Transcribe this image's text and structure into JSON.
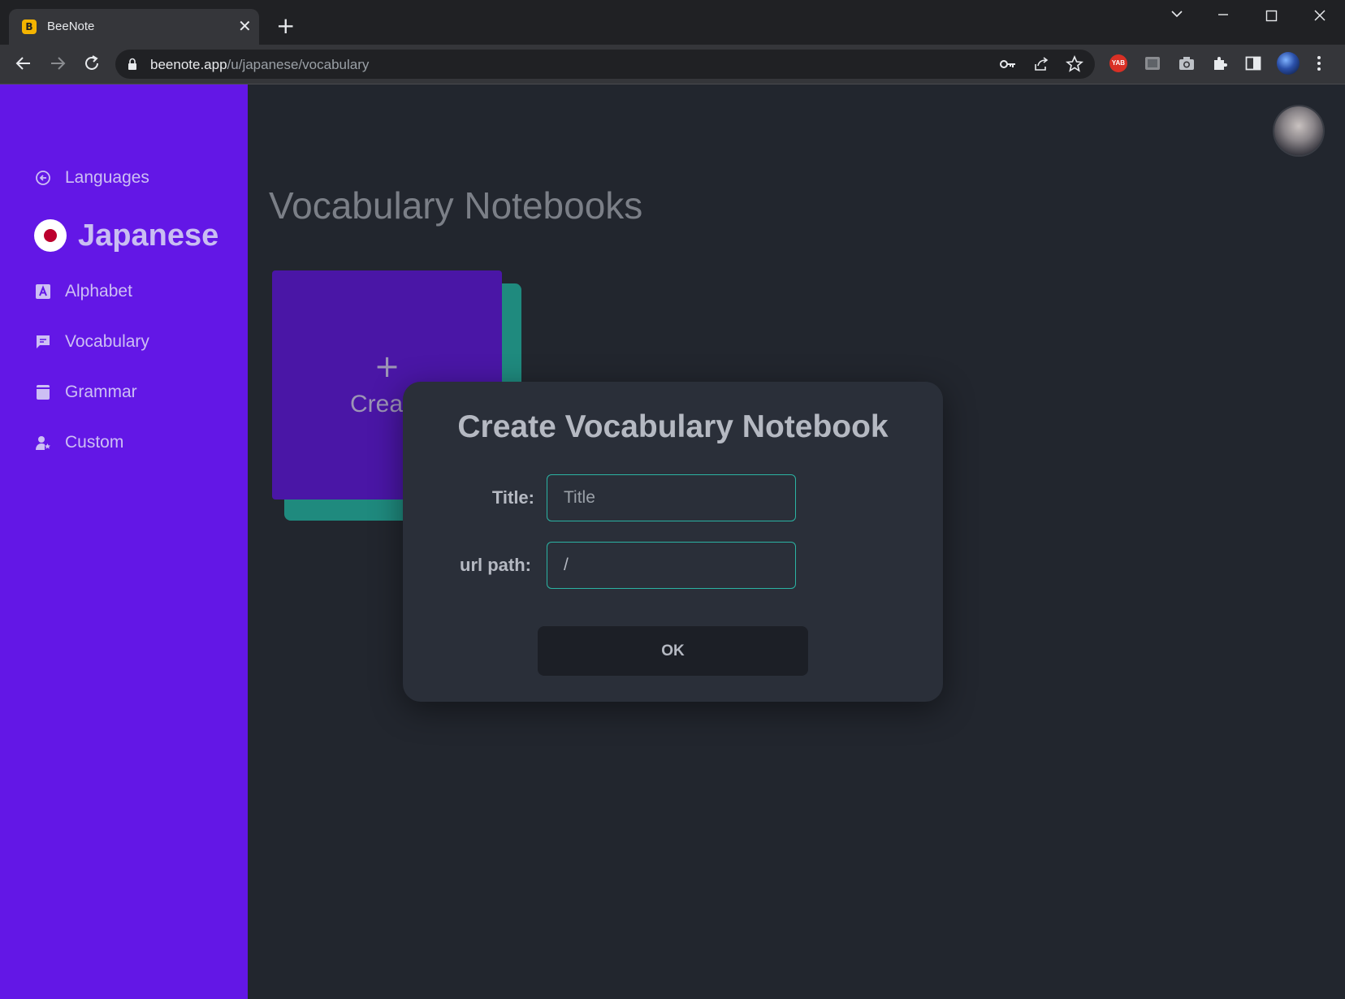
{
  "browser": {
    "tab_title": "BeeNote",
    "tab_favicon_letter": "B",
    "url_host": "beenote.app",
    "url_path": "/u/japanese/vocabulary",
    "ext_badge": "YAB"
  },
  "sidebar": {
    "back_label": "Languages",
    "language": "Japanese",
    "items": [
      {
        "label": "Alphabet",
        "icon": "alphabet-icon"
      },
      {
        "label": "Vocabulary",
        "icon": "chat-icon"
      },
      {
        "label": "Grammar",
        "icon": "book-icon"
      },
      {
        "label": "Custom",
        "icon": "user-star-icon"
      }
    ],
    "color": "#6317e6"
  },
  "main": {
    "page_title": "Vocabulary Notebooks",
    "create_card": {
      "plus": "+",
      "label": "Crea"
    }
  },
  "modal": {
    "title": "Create Vocabulary Notebook",
    "title_label": "Title:",
    "title_placeholder": "Title",
    "url_label": "url path:",
    "url_value": "/",
    "ok_label": "OK",
    "accent": "#2bb3a3"
  }
}
